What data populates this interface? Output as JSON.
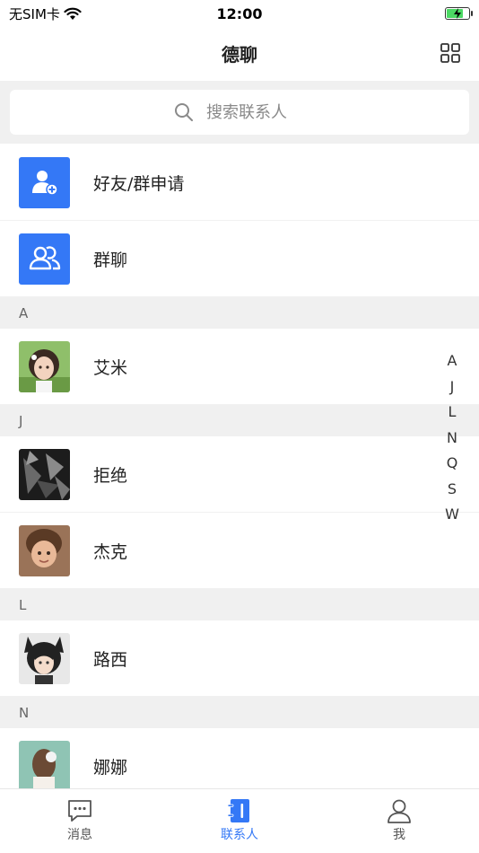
{
  "status_bar": {
    "carrier": "无SIM卡",
    "time": "12:00"
  },
  "header": {
    "title": "德聊"
  },
  "search": {
    "placeholder": "搜索联系人"
  },
  "actions": [
    {
      "label": "好友/群申请",
      "icon": "add-user-icon",
      "color": "#3478f6"
    },
    {
      "label": "群聊",
      "icon": "group-icon",
      "color": "#3478f6"
    }
  ],
  "sections": [
    {
      "letter": "A",
      "contacts": [
        {
          "name": "艾米"
        }
      ]
    },
    {
      "letter": "J",
      "contacts": [
        {
          "name": "拒绝"
        },
        {
          "name": "杰克"
        }
      ]
    },
    {
      "letter": "L",
      "contacts": [
        {
          "name": "路西"
        }
      ]
    },
    {
      "letter": "N",
      "contacts": [
        {
          "name": "娜娜"
        }
      ]
    }
  ],
  "index_letters": [
    "A",
    "J",
    "L",
    "N",
    "Q",
    "S",
    "W"
  ],
  "tabs": [
    {
      "label": "消息",
      "icon": "message-icon",
      "active": false
    },
    {
      "label": "联系人",
      "icon": "contacts-icon",
      "active": true
    },
    {
      "label": "我",
      "icon": "profile-icon",
      "active": false
    }
  ],
  "colors": {
    "accent": "#3478f6",
    "section_bg": "#f0f0f0"
  }
}
